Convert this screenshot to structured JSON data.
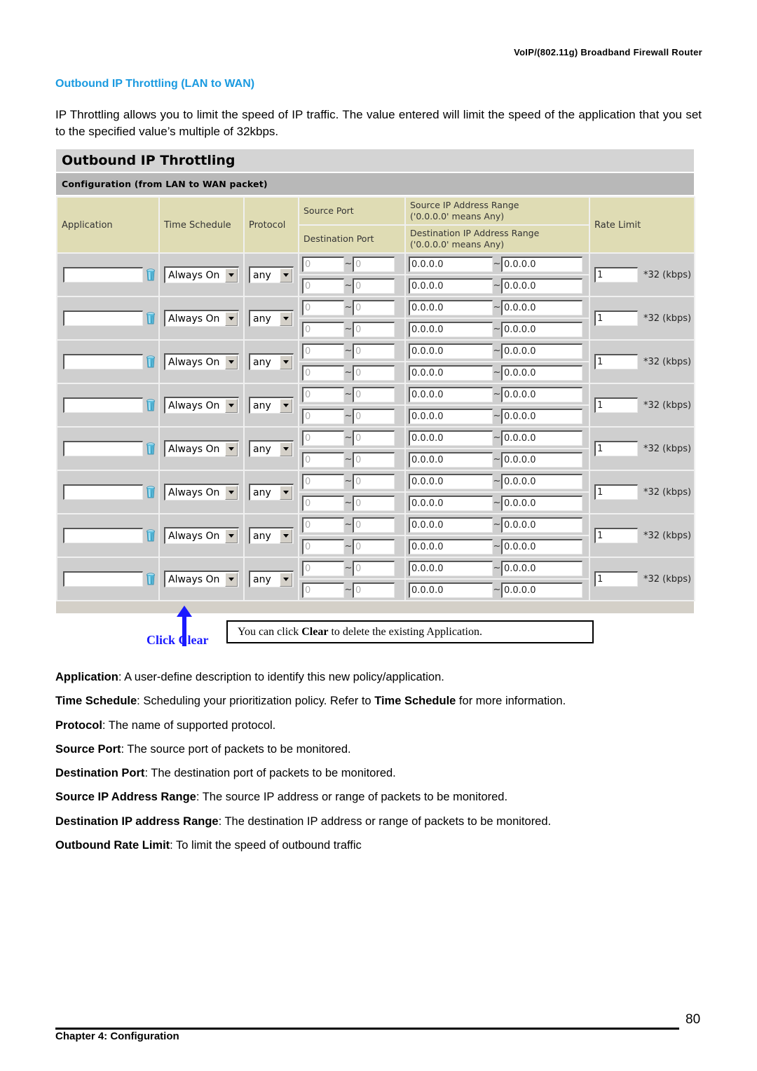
{
  "header": {
    "product": "VoIP/(802.11g)  Broadband  Firewall  Router"
  },
  "section": {
    "title": "Outbound IP Throttling (LAN to WAN)",
    "intro": "IP Throttling allows you to limit the speed of IP traffic. The value entered will limit the speed of the application that you set to the specified value’s multiple of 32kbps."
  },
  "screenshot": {
    "title": "Outbound IP Throttling",
    "subtitle": "Configuration (from LAN to WAN packet)",
    "columns": {
      "application": "Application",
      "time_schedule": "Time Schedule",
      "protocol": "Protocol",
      "source_port": "Source Port",
      "destination_port": "Destination Port",
      "source_ip_range": "Source IP Address Range",
      "source_ip_note": "('0.0.0.0' means Any)",
      "dest_ip_range": "Destination IP Address Range",
      "dest_ip_note": "('0.0.0.0' means Any)",
      "rate_limit": "Rate Limit"
    },
    "rows": [
      {
        "application": "",
        "time_schedule": "Always On",
        "protocol": "any",
        "src_port_from": "0",
        "src_port_to": "0",
        "dst_port_from": "0",
        "dst_port_to": "0",
        "src_ip_from": "0.0.0.0",
        "src_ip_to": "0.0.0.0",
        "dst_ip_from": "0.0.0.0",
        "dst_ip_to": "0.0.0.0",
        "rate": "1",
        "rate_unit": "*32 (kbps)"
      },
      {
        "application": "",
        "time_schedule": "Always On",
        "protocol": "any",
        "src_port_from": "0",
        "src_port_to": "0",
        "dst_port_from": "0",
        "dst_port_to": "0",
        "src_ip_from": "0.0.0.0",
        "src_ip_to": "0.0.0.0",
        "dst_ip_from": "0.0.0.0",
        "dst_ip_to": "0.0.0.0",
        "rate": "1",
        "rate_unit": "*32 (kbps)"
      },
      {
        "application": "",
        "time_schedule": "Always On",
        "protocol": "any",
        "src_port_from": "0",
        "src_port_to": "0",
        "dst_port_from": "0",
        "dst_port_to": "0",
        "src_ip_from": "0.0.0.0",
        "src_ip_to": "0.0.0.0",
        "dst_ip_from": "0.0.0.0",
        "dst_ip_to": "0.0.0.0",
        "rate": "1",
        "rate_unit": "*32 (kbps)"
      },
      {
        "application": "",
        "time_schedule": "Always On",
        "protocol": "any",
        "src_port_from": "0",
        "src_port_to": "0",
        "dst_port_from": "0",
        "dst_port_to": "0",
        "src_ip_from": "0.0.0.0",
        "src_ip_to": "0.0.0.0",
        "dst_ip_from": "0.0.0.0",
        "dst_ip_to": "0.0.0.0",
        "rate": "1",
        "rate_unit": "*32 (kbps)"
      },
      {
        "application": "",
        "time_schedule": "Always On",
        "protocol": "any",
        "src_port_from": "0",
        "src_port_to": "0",
        "dst_port_from": "0",
        "dst_port_to": "0",
        "src_ip_from": "0.0.0.0",
        "src_ip_to": "0.0.0.0",
        "dst_ip_from": "0.0.0.0",
        "dst_ip_to": "0.0.0.0",
        "rate": "1",
        "rate_unit": "*32 (kbps)"
      },
      {
        "application": "",
        "time_schedule": "Always On",
        "protocol": "any",
        "src_port_from": "0",
        "src_port_to": "0",
        "dst_port_from": "0",
        "dst_port_to": "0",
        "src_ip_from": "0.0.0.0",
        "src_ip_to": "0.0.0.0",
        "dst_ip_from": "0.0.0.0",
        "dst_ip_to": "0.0.0.0",
        "rate": "1",
        "rate_unit": "*32 (kbps)"
      },
      {
        "application": "",
        "time_schedule": "Always On",
        "protocol": "any",
        "src_port_from": "0",
        "src_port_to": "0",
        "dst_port_from": "0",
        "dst_port_to": "0",
        "src_ip_from": "0.0.0.0",
        "src_ip_to": "0.0.0.0",
        "dst_ip_from": "0.0.0.0",
        "dst_ip_to": "0.0.0.0",
        "rate": "1",
        "rate_unit": "*32 (kbps)"
      },
      {
        "application": "",
        "time_schedule": "Always On",
        "protocol": "any",
        "src_port_from": "0",
        "src_port_to": "0",
        "dst_port_from": "0",
        "dst_port_to": "0",
        "src_ip_from": "0.0.0.0",
        "src_ip_to": "0.0.0.0",
        "dst_ip_from": "0.0.0.0",
        "dst_ip_to": "0.0.0.0",
        "rate": "1",
        "rate_unit": "*32 (kbps)"
      }
    ],
    "icons": {
      "clear": "trash-can-icon"
    }
  },
  "annotation": {
    "label": "Click Clear",
    "note_prefix": "You can click ",
    "note_bold": "Clear",
    "note_suffix": " to delete the existing Application.",
    "label_color": "#1a1aff"
  },
  "definitions": [
    {
      "term": "Application",
      "text": ": A user-define description to identify this new policy/application."
    },
    {
      "term": "Time Schedule",
      "text": ": Scheduling your prioritization policy. Refer to ",
      "term2": "Time Schedule",
      "text2": " for more information."
    },
    {
      "term": "Protocol",
      "text": ": The name of supported protocol."
    },
    {
      "term": "Source Port",
      "text": ": The source port of packets to be monitored."
    },
    {
      "term": "Destination Port",
      "text": ": The destination port of packets to be monitored."
    },
    {
      "term": "Source IP Address Range",
      "text": ": The source IP address or range of packets to be monitored."
    },
    {
      "term": "Destination IP address Range",
      "text": ": The destination IP address or range of packets to be monitored."
    },
    {
      "term": "Outbound Rate Limit",
      "text": ": To limit the speed of outbound traffic"
    }
  ],
  "footer": {
    "page_number": "80",
    "chapter": "Chapter 4: Configuration"
  },
  "colors": {
    "section_title": "#1a9ae0",
    "header_cell_bg": "#dfdcb4",
    "data_cell_bg": "#cfcfcf"
  }
}
